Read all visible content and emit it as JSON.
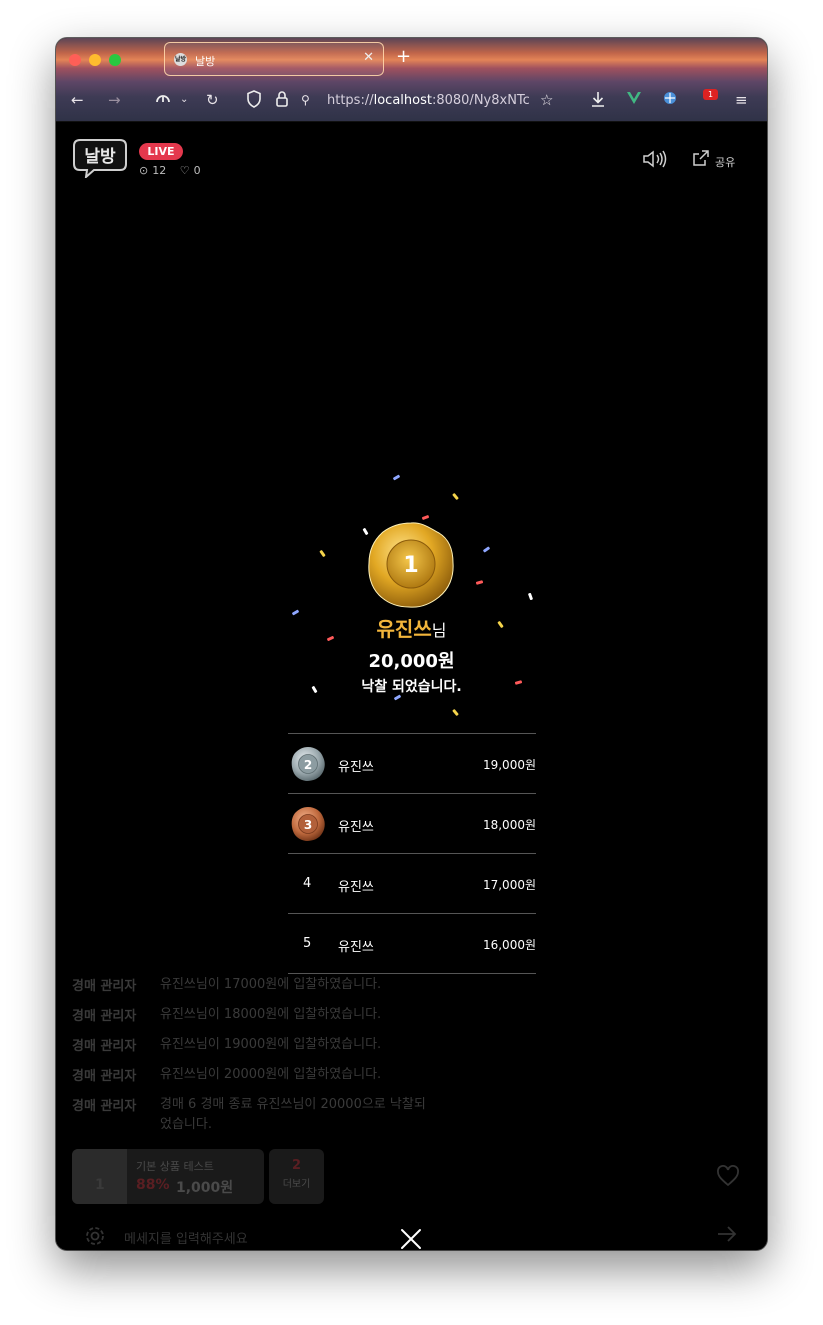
{
  "browser": {
    "tab_title": "날방",
    "tab_favicon_text": "날방",
    "url_prefix": "https://",
    "url_host": "localhost",
    "url_rest": ":8080/Ny8xNTc",
    "extension_badge": "1"
  },
  "header": {
    "logo_text": "날방",
    "live_label": "LIVE",
    "viewer_count": "12",
    "like_count": "0",
    "share_label": "공유"
  },
  "result": {
    "winner_medal_number": "1",
    "winner_name": "유진쓰",
    "winner_suffix": "님",
    "winner_price": "20,000원",
    "winner_message": "낙찰 되었습니다.",
    "ranks": [
      {
        "rank": "2",
        "name": "유진쓰",
        "amount": "19,000원",
        "medal": "silver"
      },
      {
        "rank": "3",
        "name": "유진쓰",
        "amount": "18,000원",
        "medal": "bronze"
      },
      {
        "rank": "4",
        "name": "유진쓰",
        "amount": "17,000원",
        "medal": "none"
      },
      {
        "rank": "5",
        "name": "유진쓰",
        "amount": "16,000원",
        "medal": "none"
      }
    ]
  },
  "chat": {
    "messages": [
      {
        "author": "경매 관리자",
        "text": "유진쓰님이 17000원에 입찰하였습니다."
      },
      {
        "author": "경매 관리자",
        "text": "유진쓰님이 18000원에 입찰하였습니다."
      },
      {
        "author": "경매 관리자",
        "text": "유진쓰님이 19000원에 입찰하였습니다."
      },
      {
        "author": "경매 관리자",
        "text": "유진쓰님이 20000원에 입찰하였습니다."
      },
      {
        "author": "경매 관리자",
        "text": "경매 6 경매 종료 유진쓰님이 20000으로 낙찰되었습니다."
      }
    ],
    "input_placeholder": "메세지를 입력해주세요"
  },
  "product": {
    "thumb_text": "1",
    "name": "기본 상품 테스트",
    "discount": "88%",
    "price": "1,000원",
    "more_count": "2",
    "more_label": "더보기"
  },
  "colors": {
    "accent_gold": "#f2b53b",
    "live_red": "#e4384d"
  }
}
